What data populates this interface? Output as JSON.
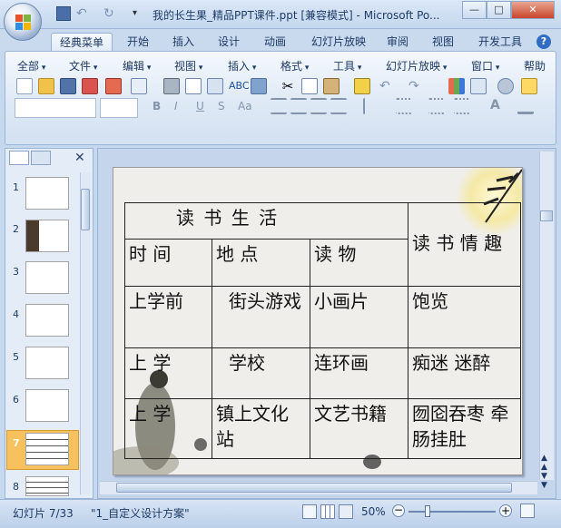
{
  "window": {
    "title": "我的长生果_精品PPT课件.ppt [兼容模式] - Microsoft Po...",
    "minimize": "—",
    "maximize": "□",
    "close": "✕"
  },
  "ribbon_tabs": [
    "经典菜单",
    "开始",
    "插入",
    "设计",
    "动画",
    "幻灯片放映",
    "审阅",
    "视图",
    "开发工具"
  ],
  "help": "?",
  "menus": [
    "全部",
    "文件",
    "编辑",
    "视图",
    "插入",
    "格式",
    "工具",
    "幻灯片放映",
    "窗口",
    "帮助"
  ],
  "format_buttons": {
    "bold": "B",
    "italic": "I",
    "underline": "U",
    "strike": "S",
    "case": "Aa",
    "font_size_up": "A"
  },
  "slide": {
    "header_title": "读  书  生  活",
    "header_feel": "读 书 情 趣",
    "col_time": "时 间",
    "col_place": "地    点",
    "col_read": "读    物",
    "rows": [
      {
        "time": "上学前",
        "place": "街头游戏",
        "read": "小画片",
        "feel": "饱览"
      },
      {
        "time": "上    学",
        "place": "学校",
        "read": "连环画",
        "feel": "痴迷  迷醉"
      },
      {
        "time": "上    学",
        "place": "镇上文化站",
        "read": "文艺书籍",
        "feel": "囫囵吞枣 牵肠挂肚"
      }
    ]
  },
  "thumbnails": [
    "1",
    "2",
    "3",
    "4",
    "5",
    "6",
    "7",
    "8"
  ],
  "status": {
    "slide_counter": "幻灯片 7/33",
    "theme": "\"1_自定义设计方案\"",
    "zoom": "50%"
  },
  "colors": {
    "accent": "#f7c15e",
    "ribbon": "#dde8f5",
    "title": "#1f3c68"
  }
}
